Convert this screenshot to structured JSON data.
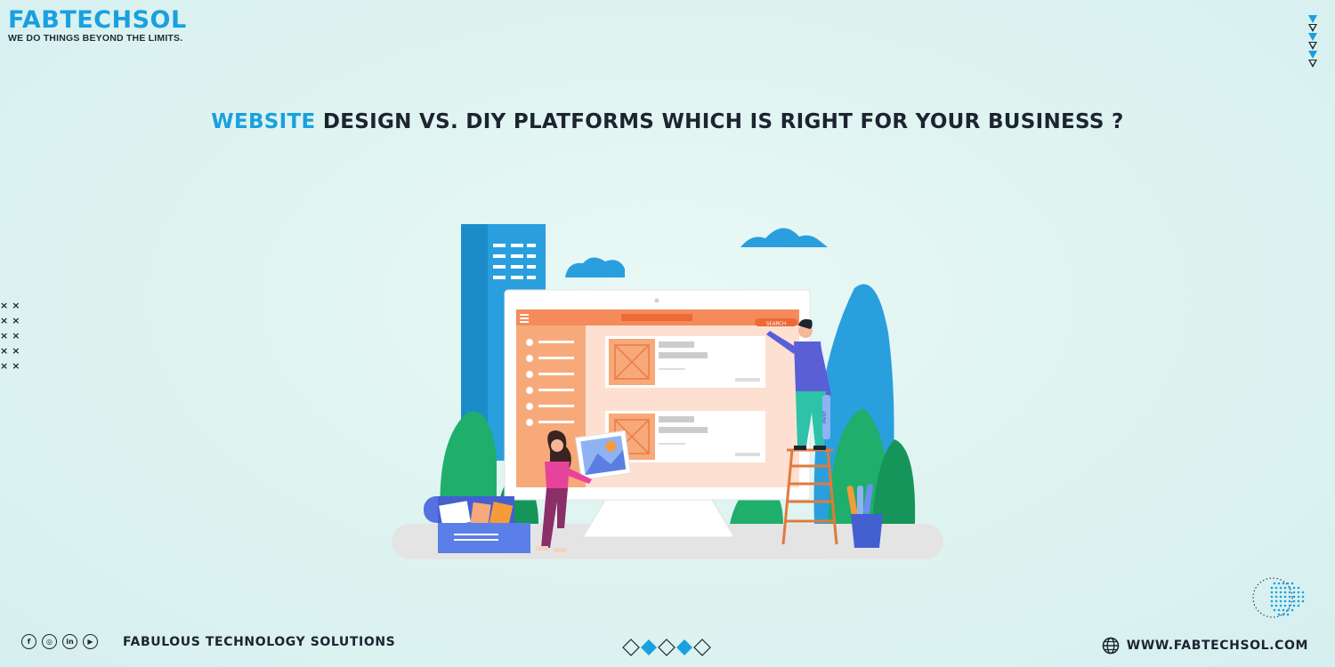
{
  "brand": {
    "name": "FABTECHSOL",
    "tagline": "WE DO THINGS BEYOND THE LIMITS."
  },
  "headline": {
    "accent": "WEBSITE",
    "rest": " DESIGN VS. DIY PLATFORMS WHICH IS RIGHT FOR YOUR BUSINESS ?"
  },
  "illustration": {
    "search_label": "SEARCH",
    "paint_label": "PAINT"
  },
  "footer": {
    "social": [
      {
        "icon": "facebook-icon",
        "glyph": "f"
      },
      {
        "icon": "instagram-icon",
        "glyph": "◎"
      },
      {
        "icon": "linkedin-icon",
        "glyph": "in"
      },
      {
        "icon": "youtube-icon",
        "glyph": "▶"
      }
    ],
    "company": "FABULOUS TECHNOLOGY SOLUTIONS",
    "website": "WWW.FABTECHSOL.COM"
  },
  "colors": {
    "accent": "#1aa0e0",
    "dark": "#1d2430",
    "background": "#dff4f1"
  }
}
